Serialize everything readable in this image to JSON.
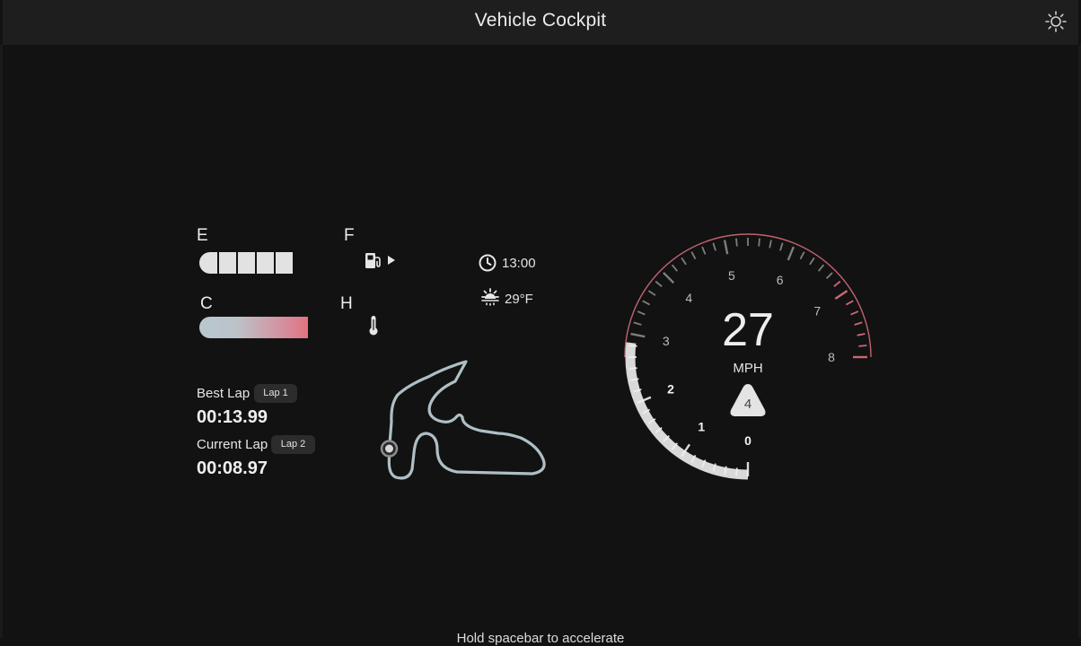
{
  "header": {
    "title": "Vehicle Cockpit",
    "theme_icon": "sun-icon"
  },
  "fuel": {
    "empty_label": "E",
    "full_label": "F",
    "level_segments": 5,
    "icon": "fuel-pump-icon"
  },
  "temperature": {
    "cold_label": "C",
    "hot_label": "H",
    "level": 0.72,
    "icon": "thermometer-icon"
  },
  "clock": {
    "time": "13:00",
    "icon": "clock-icon"
  },
  "weather": {
    "temperature": "29°F",
    "icon": "sun-cloud-icon"
  },
  "laps": {
    "best_label": "Best Lap",
    "best_chip": "Lap 1",
    "best_time": "00:13.99",
    "current_label": "Current Lap",
    "current_chip": "Lap 2",
    "current_time": "00:08.97"
  },
  "speedometer": {
    "speed": "27",
    "unit": "MPH",
    "gear": "4",
    "tick_labels": [
      "0",
      "1",
      "2",
      "3",
      "4",
      "5",
      "6",
      "7",
      "8"
    ],
    "accent": "#e0727f"
  },
  "footer": {
    "hint": "Hold spacebar to accelerate"
  }
}
